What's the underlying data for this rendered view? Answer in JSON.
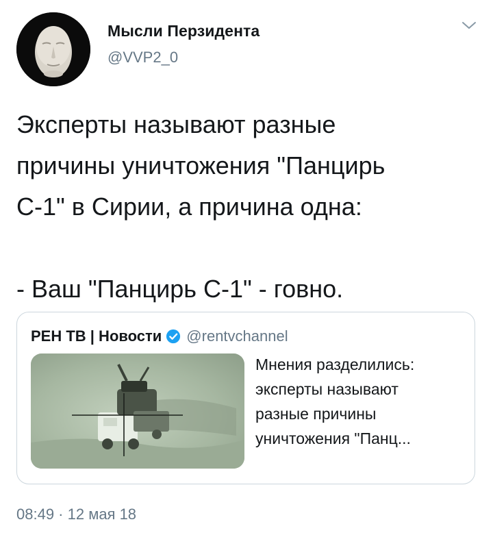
{
  "author": {
    "display_name": "Мысли Перзидента",
    "handle": "@VVP2_0",
    "avatar_icon": "mask-avatar-icon"
  },
  "menu_icon": "chevron-down-icon",
  "tweet": {
    "lines": [
      "Эксперты называют разные",
      "причины уничтожения \"Панцирь",
      "С-1\" в Сирии, а причина одна:",
      "",
      "- Ваш \"Панцирь С-1\" - говно."
    ],
    "timestamp": "08:49 · 12 мая 18"
  },
  "quoted_tweet": {
    "name": "РЕН ТВ | Новости",
    "verified_icon": "verified-badge-icon",
    "handle": "@rentvchannel",
    "thumbnail_icon": "military-vehicle-crosshair-image",
    "text_lines": [
      "Мнения разделились:",
      "эксперты называют",
      "разные причины",
      "уничтожения \"Панц..."
    ]
  },
  "colors": {
    "text": "#14171a",
    "secondary_text": "#657786",
    "border": "#ccd6dd",
    "verified": "#1da1f2"
  }
}
